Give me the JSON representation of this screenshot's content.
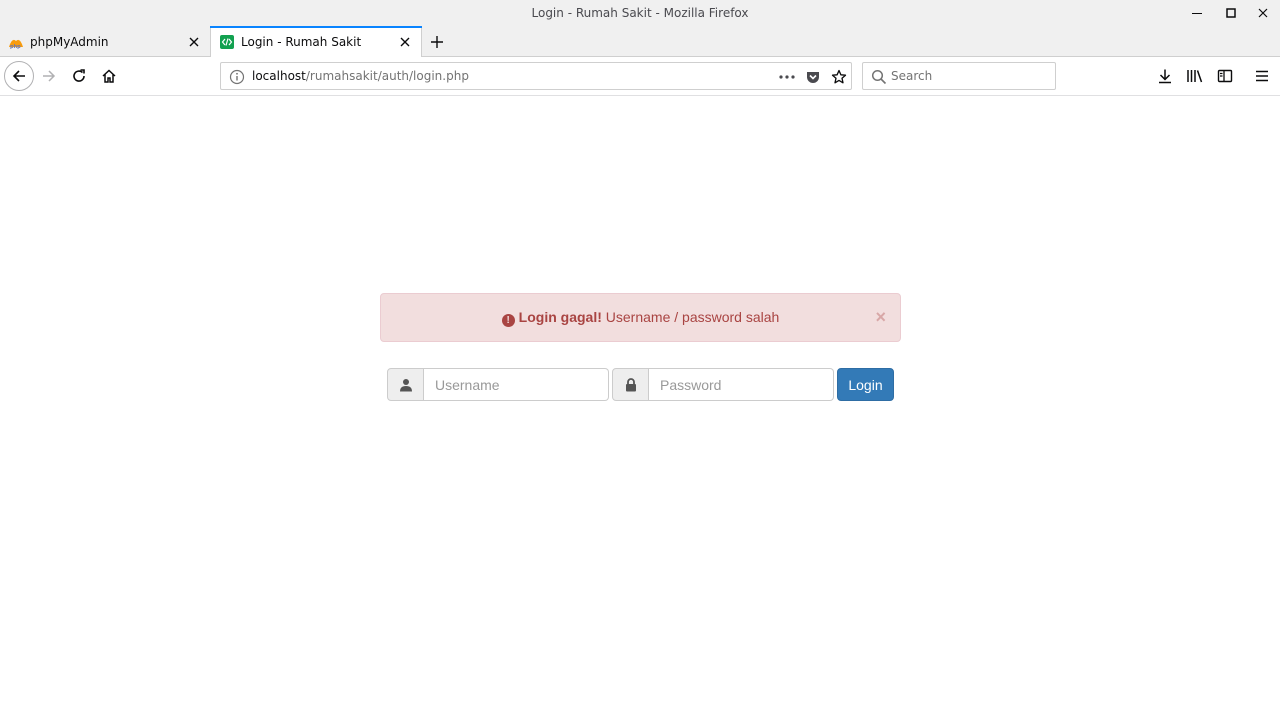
{
  "window": {
    "title": "Login - Rumah Sakit - Mozilla Firefox"
  },
  "tabs": [
    {
      "label": "phpMyAdmin",
      "active": false,
      "favicon": "phpmyadmin-icon"
    },
    {
      "label": "Login - Rumah Sakit",
      "active": true,
      "favicon": "code-icon"
    }
  ],
  "navbar": {
    "url_host": "localhost",
    "url_path": "/rumahsakit/auth/login.php",
    "search_placeholder": "Search"
  },
  "alert": {
    "strong": "Login gagal!",
    "text": " Username / password salah",
    "close": "×"
  },
  "login_form": {
    "username_placeholder": "Username",
    "username_value": "",
    "password_placeholder": "Password",
    "password_value": "",
    "button_label": "Login"
  },
  "colors": {
    "accent": "#0a84ff",
    "alert_bg": "#f2dede",
    "alert_text": "#a94442",
    "button_primary": "#337ab7"
  }
}
